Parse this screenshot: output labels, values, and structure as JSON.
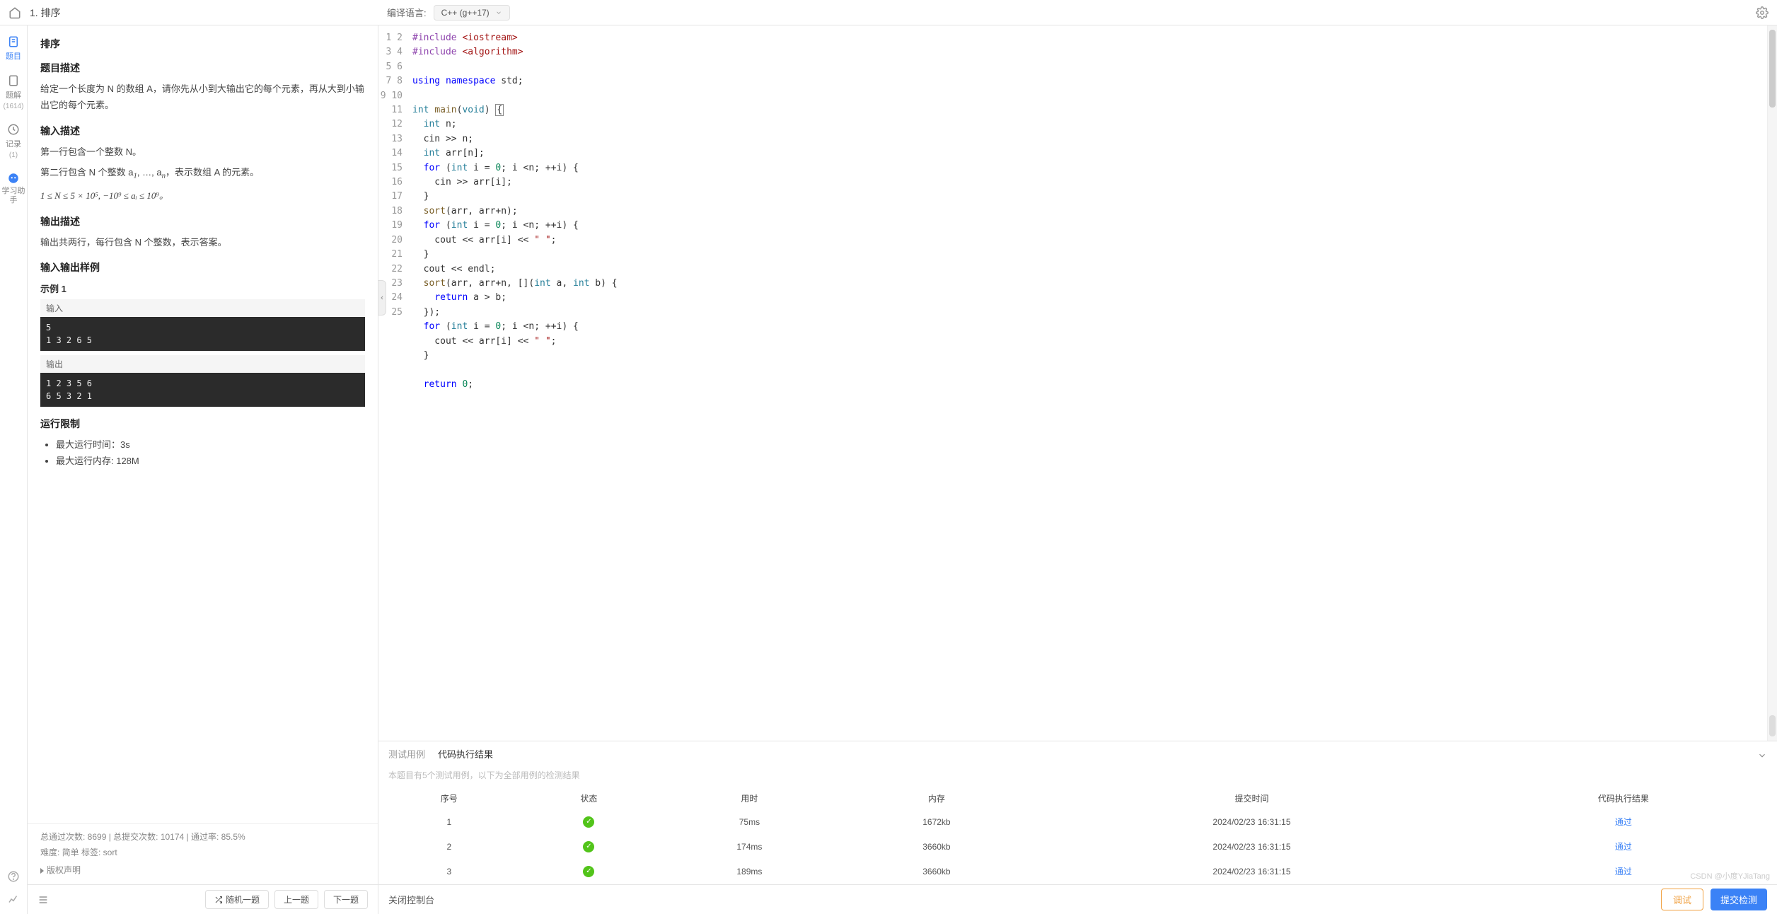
{
  "page_title": "1. 排序",
  "language_label": "编译语言:",
  "language_value": "C++ (g++17)",
  "sidebar": {
    "items": [
      {
        "label": "题目"
      },
      {
        "label": "题解",
        "count": "(1614)"
      },
      {
        "label": "记录",
        "count": "(1)"
      },
      {
        "label": "学习助手"
      }
    ]
  },
  "problem": {
    "title": "排序",
    "desc_heading": "题目描述",
    "desc_text": "给定一个长度为 N 的数组 A，请你先从小到大输出它的每个元素，再从大到小输出它的每个元素。",
    "input_heading": "输入描述",
    "input_line1": "第一行包含一个整数 N。",
    "input_line2_pre": "第二行包含 N 个整数 a",
    "input_line2_mid": "1, …, a",
    "input_line2_post": "，表示数组 A 的元素。",
    "input_constraint": "1 ≤ N ≤ 5 × 10⁵, −10⁹ ≤ aᵢ ≤ 10⁹。",
    "output_heading": "输出描述",
    "output_text": "输出共两行，每行包含 N 个整数，表示答案。",
    "sample_heading": "输入输出样例",
    "sample_label": "示例 1",
    "input_label": "输入",
    "sample_input": "5\n1 3 2 6 5",
    "output_label": "输出",
    "sample_output": "1 2 3 5 6\n6 5 3 2 1",
    "limit_heading": "运行限制",
    "limit_time": "最大运行时间：3s",
    "limit_mem": "最大运行内存: 128M",
    "stats": "总通过次数: 8699  |  总提交次数: 10174  |  通过率: 85.5%",
    "meta": "难度: 简单   标签: sort",
    "copyright": "版权声明"
  },
  "footer_buttons": {
    "random": "随机一题",
    "prev": "上一题",
    "next": "下一题"
  },
  "code_lines": [
    {
      "n": "1",
      "html": "<span class='c-pp'>#include</span> <span class='c-st'>&lt;iostream&gt;</span>"
    },
    {
      "n": "2",
      "html": "<span class='c-pp'>#include</span> <span class='c-st'>&lt;algorithm&gt;</span>"
    },
    {
      "n": "3",
      "html": ""
    },
    {
      "n": "4",
      "html": "<span class='c-kw'>using</span> <span class='c-kw'>namespace</span> std;"
    },
    {
      "n": "5",
      "html": ""
    },
    {
      "n": "6",
      "html": "<span class='c-ty'>int</span> <span class='c-fn'>main</span>(<span class='c-ty'>void</span>) <span class='cursor-box'>{</span>"
    },
    {
      "n": "7",
      "html": "  <span class='c-ty'>int</span> n;"
    },
    {
      "n": "8",
      "html": "  cin &gt;&gt; n;"
    },
    {
      "n": "9",
      "html": "  <span class='c-ty'>int</span> arr[n];"
    },
    {
      "n": "10",
      "html": "  <span class='c-kw'>for</span> (<span class='c-ty'>int</span> i = <span class='c-nu'>0</span>; i &lt;n; ++i) {"
    },
    {
      "n": "11",
      "html": "    cin &gt;&gt; arr[i];"
    },
    {
      "n": "12",
      "html": "  }"
    },
    {
      "n": "13",
      "html": "  <span class='c-fn'>sort</span>(arr, arr+n);"
    },
    {
      "n": "14",
      "html": "  <span class='c-kw'>for</span> (<span class='c-ty'>int</span> i = <span class='c-nu'>0</span>; i &lt;n; ++i) {"
    },
    {
      "n": "15",
      "html": "    cout &lt;&lt; arr[i] &lt;&lt; <span class='c-st'>\" \"</span>;"
    },
    {
      "n": "16",
      "html": "  }"
    },
    {
      "n": "17",
      "html": "  cout &lt;&lt; endl;"
    },
    {
      "n": "18",
      "html": "  <span class='c-fn'>sort</span>(arr, arr+n, [](<span class='c-ty'>int</span> a, <span class='c-ty'>int</span> b) {"
    },
    {
      "n": "19",
      "html": "    <span class='c-kw'>return</span> a &gt; b;"
    },
    {
      "n": "20",
      "html": "  });"
    },
    {
      "n": "21",
      "html": "  <span class='c-kw'>for</span> (<span class='c-ty'>int</span> i = <span class='c-nu'>0</span>; i &lt;n; ++i) {"
    },
    {
      "n": "22",
      "html": "    cout &lt;&lt; arr[i] &lt;&lt; <span class='c-st'>\" \"</span>;"
    },
    {
      "n": "23",
      "html": "  }"
    },
    {
      "n": "24",
      "html": ""
    },
    {
      "n": "25",
      "html": "  <span class='c-kw'>return</span> <span class='c-nu'>0</span>;"
    }
  ],
  "console": {
    "tab_test": "测试用例",
    "tab_result": "代码执行结果",
    "info": "本题目有5个测试用例，以下为全部用例的检测结果",
    "headers": {
      "no": "序号",
      "status": "状态",
      "time": "用时",
      "mem": "内存",
      "submitted": "提交时间",
      "result": "代码执行结果"
    },
    "rows": [
      {
        "no": "1",
        "time": "75ms",
        "mem": "1672kb",
        "submitted": "2024/02/23 16:31:15",
        "result": "通过"
      },
      {
        "no": "2",
        "time": "174ms",
        "mem": "3660kb",
        "submitted": "2024/02/23 16:31:15",
        "result": "通过"
      },
      {
        "no": "3",
        "time": "189ms",
        "mem": "3660kb",
        "submitted": "2024/02/23 16:31:15",
        "result": "通过"
      }
    ],
    "close_label": "关闭控制台",
    "debug_label": "调试",
    "submit_label": "提交检测"
  },
  "watermark": "CSDN @小度YJiaTang"
}
